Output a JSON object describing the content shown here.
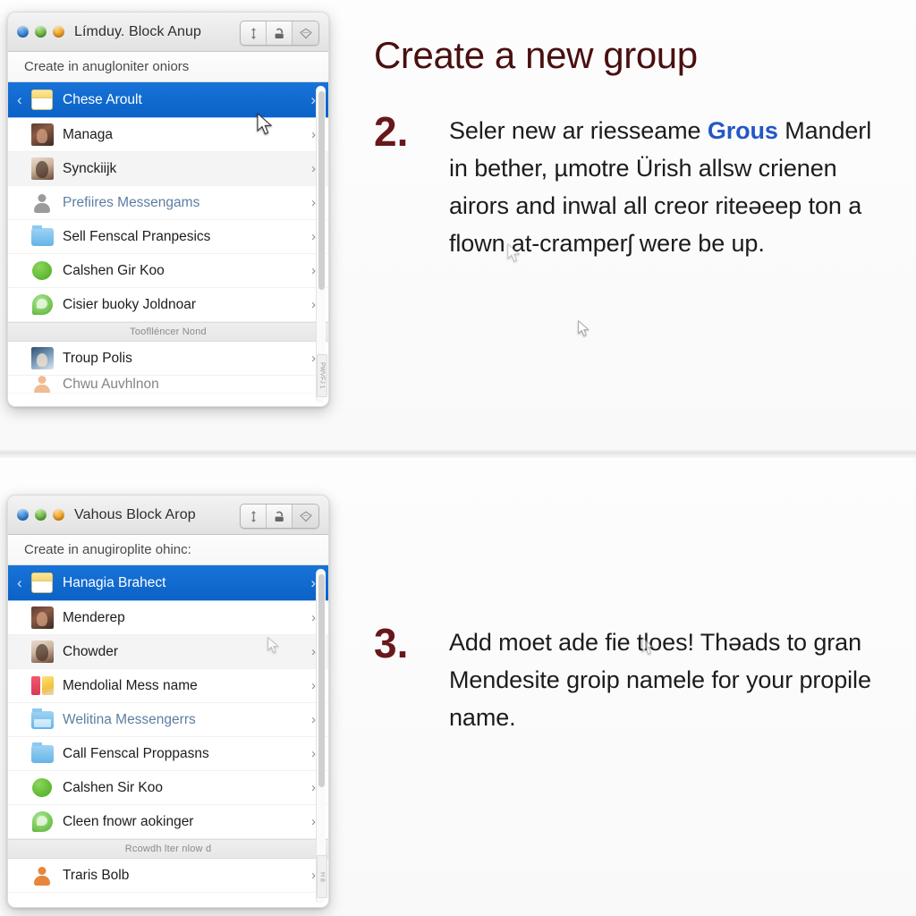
{
  "colors": {
    "heading": "#4a0f10",
    "step_number": "#68171a",
    "accent_link": "#2457c5",
    "selection_blue": "#1873d8",
    "page_background": "#fbfbfb"
  },
  "sections": [
    {
      "window": {
        "title": "Límduy. Block Anup",
        "traffic_lights": [
          "blue-dot",
          "green-dot",
          "orange-dot"
        ],
        "toolbar_icons": [
          "align-icon",
          "stamp-icon",
          "gem-icon"
        ],
        "breadcrumb": "Create in anugloniter oniors",
        "rows": [
          {
            "label": "Chese Aroult",
            "icon": "note-icon",
            "selected": true,
            "back": true
          },
          {
            "label": "Managa",
            "icon": "photo-avatar-icon"
          },
          {
            "label": "Synckiijk",
            "icon": "photo-avatar-icon"
          },
          {
            "label": "Prefiires Messengams",
            "icon": "person-gray-icon",
            "muted": true
          },
          {
            "label": "Sell Fenscal Pranpesics",
            "icon": "folder-blue-icon"
          },
          {
            "label": "Calshen Gir Koo",
            "icon": "green-blob-icon"
          },
          {
            "label": "Cisier buoky Joldnoar",
            "icon": "chat-bubble-icon"
          },
          {
            "separator": "Tooflléncer Nond"
          },
          {
            "label": "Troup Polis",
            "icon": "photo-avatar-icon"
          },
          {
            "label": "Chwu Auvhlnon",
            "icon": "person-orange-icon",
            "cut": true
          }
        ],
        "edge_tab_label": "PWVFJ 1"
      },
      "content": {
        "heading": "Create a new group",
        "step_number": "2.",
        "paragraph_parts": [
          {
            "text": "Seler new ar riesseame "
          },
          {
            "text": "Grous",
            "accent": true
          },
          {
            "text": " Manderl in bether, µmotre Ürish allsw crienen airors and inwal all creor riteəeep ton a flown at-cramperʃ were be up."
          }
        ]
      }
    },
    {
      "window": {
        "title": "Vahous Block Arop",
        "traffic_lights": [
          "blue-dot",
          "green-dot",
          "orange-dot"
        ],
        "toolbar_icons": [
          "align-icon",
          "stamp-icon",
          "gem-icon"
        ],
        "breadcrumb": "Create in anugiroplite ohinc:",
        "rows": [
          {
            "label": "Hanagia Brahect",
            "icon": "note-icon",
            "selected": true,
            "back": true
          },
          {
            "label": "Menderep",
            "icon": "photo-avatar-icon"
          },
          {
            "label": "Chowder",
            "icon": "photo-avatar-icon"
          },
          {
            "label": "Mendolial Mess name",
            "icon": "mixed-tile-icon"
          },
          {
            "label": "Welitina Messengerrs",
            "icon": "folder-picture-icon",
            "muted": true
          },
          {
            "label": "Call Fenscal Proppasns",
            "icon": "folder-blue-icon"
          },
          {
            "label": "Calshen Sir Koo",
            "icon": "green-blob-icon"
          },
          {
            "label": "Cleen fnowr aokinger",
            "icon": "chat-bubble-icon"
          },
          {
            "separator": "Rcowdh lter nlow d"
          },
          {
            "label": "Traris Bolb",
            "icon": "person-orange-icon"
          }
        ],
        "edge_tab_label": "H 8"
      },
      "content": {
        "heading": "",
        "step_number": "3.",
        "paragraph_parts": [
          {
            "text": "Add moet ade fie tloes! Thəads to gran Mendesite groip namele for your propile name."
          }
        ]
      }
    }
  ]
}
